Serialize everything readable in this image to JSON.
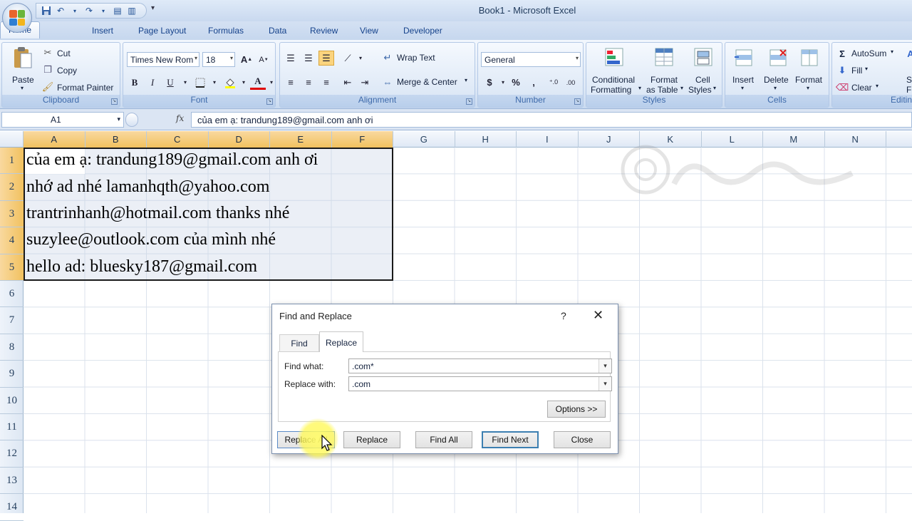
{
  "window": {
    "title": "Book1 - Microsoft Excel"
  },
  "ribbon": {
    "tabs": [
      "Home",
      "Insert",
      "Page Layout",
      "Formulas",
      "Data",
      "Review",
      "View",
      "Developer"
    ],
    "clipboard": {
      "label": "Clipboard",
      "paste": "Paste",
      "cut": "Cut",
      "copy": "Copy",
      "format_painter": "Format Painter"
    },
    "font": {
      "label": "Font",
      "name": "Times New Rom",
      "size": "18"
    },
    "alignment": {
      "label": "Alignment",
      "wrap_text": "Wrap Text",
      "merge_center": "Merge & Center"
    },
    "number": {
      "label": "Number",
      "format": "General"
    },
    "styles": {
      "label": "Styles",
      "conditional_1": "Conditional",
      "conditional_2": "Formatting",
      "format_table_1": "Format",
      "format_table_2": "as Table",
      "cell_styles_1": "Cell",
      "cell_styles_2": "Styles"
    },
    "cells": {
      "label": "Cells",
      "insert": "Insert",
      "delete": "Delete",
      "format": "Format"
    },
    "editing": {
      "label": "Editing",
      "autosum": "AutoSum",
      "fill": "Fill",
      "clear": "Clear",
      "sort_1": "So",
      "sort_2": "Fil"
    }
  },
  "formula_bar": {
    "name_box": "A1",
    "fx": "fx",
    "content": "của em ạ: trandung189@gmail.com anh ơi"
  },
  "grid": {
    "columns": [
      "A",
      "B",
      "C",
      "D",
      "E",
      "F",
      "G",
      "H",
      "I",
      "J",
      "K",
      "L",
      "M",
      "N"
    ],
    "rows": [
      "1",
      "2",
      "3",
      "4",
      "5",
      "6",
      "7",
      "8",
      "9",
      "10",
      "11",
      "12",
      "13",
      "14"
    ],
    "cells": [
      "của em ạ: trandung189@gmail.com anh ơi",
      "nhớ ad nhé lamanhqth@yahoo.com",
      "trantrinhanh@hotmail.com thanks nhé",
      "suzylee@outlook.com của mình nhé",
      "hello ad: bluesky187@gmail.com"
    ]
  },
  "dialog": {
    "title": "Find and Replace",
    "help": "?",
    "close_glyph": "✕",
    "tab_find": "Find",
    "tab_replace": "Replace",
    "find_label": "Find what:",
    "find_value": ".com*",
    "replace_label": "Replace with:",
    "replace_value": ".com",
    "options": "Options >>",
    "replace_all": "Replace All",
    "replace": "Replace",
    "find_all": "Find All",
    "find_next": "Find Next",
    "close": "Close"
  },
  "colors": {
    "accent": "#15428b",
    "selection_header": "#f1c15f",
    "ribbon_bg": "#dde8f6"
  }
}
